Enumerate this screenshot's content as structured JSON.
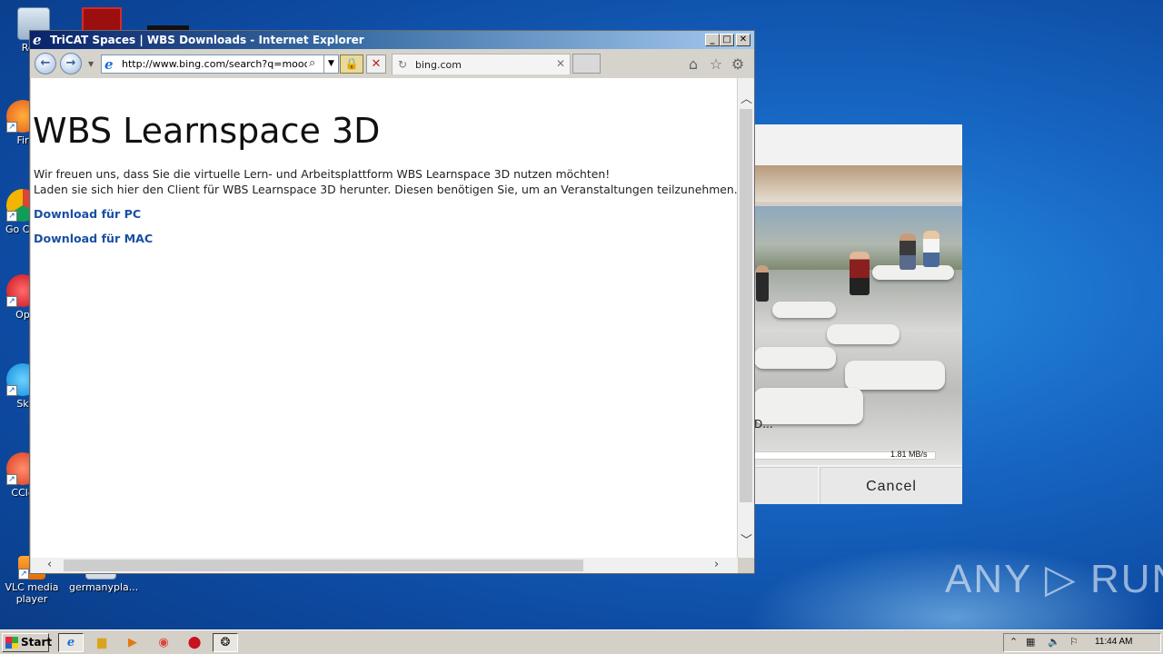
{
  "desktop": {
    "icons": [
      {
        "label": "Recy"
      },
      {
        "label": "Fir"
      },
      {
        "label": "Go Chr"
      },
      {
        "label": "Op"
      },
      {
        "label": "Sk"
      },
      {
        "label": "CCle"
      },
      {
        "label": "VLC media player"
      },
      {
        "label": "germanypla..."
      }
    ]
  },
  "installer": {
    "status": "D...",
    "speed": "1.81 MB/s",
    "cancel_label": "Cancel"
  },
  "browser": {
    "window_title": "TriCAT Spaces | WBS Downloads - Internet Explorer",
    "address_url": "http://www.bing.com/search?q=mooop&s",
    "tab_label": "bing.com",
    "back_glyph": "←",
    "forward_glyph": "→",
    "minimize_glyph": "_",
    "maximize_glyph": "□",
    "close_glyph": "✕"
  },
  "page": {
    "heading": "WBS Learnspace 3D",
    "para_line1": "Wir freuen uns, dass Sie die virtuelle Lern- und Arbeitsplattform WBS Learnspace 3D nutzen möchten!",
    "para_line2": "Laden sie sich hier den Client für WBS Learnspace 3D  herunter. Diesen benötigen Sie, um an Veranstaltungen teilzunehmen.",
    "download_pc": "Download für PC",
    "download_mac": "Download für MAC"
  },
  "watermark": "ANY ▷ RUN",
  "taskbar": {
    "start_label": "Start",
    "clock": "11:44 AM"
  }
}
